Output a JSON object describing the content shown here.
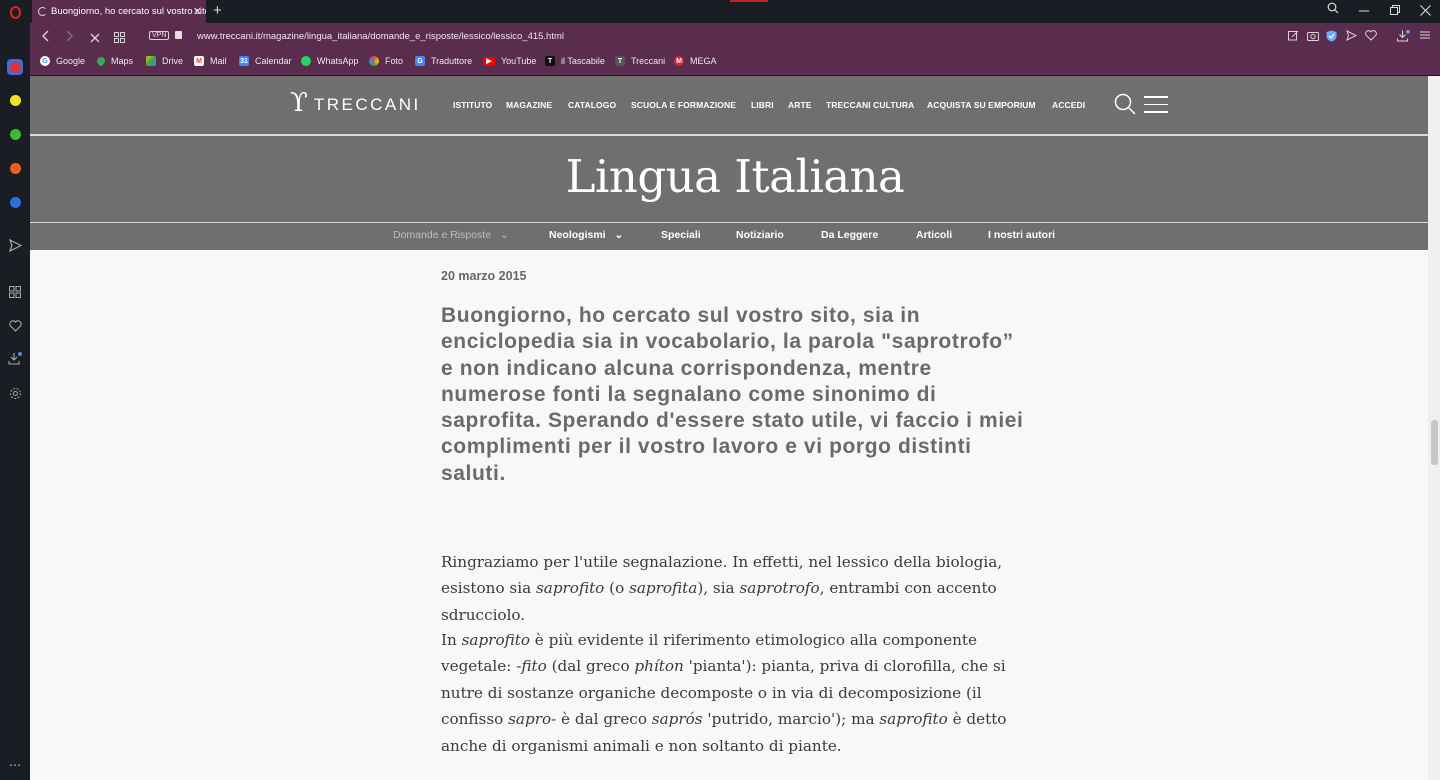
{
  "browser": {
    "tab_title": "Buongiorno, ho cercato sul vostro sito",
    "tab_close": "✕",
    "new_tab": "+",
    "url": "www.treccani.it/magazine/lingua_italiana/domande_e_risposte/lessico/lessico_415.html",
    "vpn_label": "VPN",
    "bookmarks": [
      {
        "label": "Google",
        "icon": "google-icon",
        "color": "#ffffff"
      },
      {
        "label": "Maps",
        "icon": "maps-icon",
        "color": "#34a853"
      },
      {
        "label": "Drive",
        "icon": "drive-icon",
        "color": "#fbbc05"
      },
      {
        "label": "Mail",
        "icon": "gmail-icon",
        "color": "#ea4335"
      },
      {
        "label": "Calendar",
        "icon": "calendar-icon",
        "color": "#4285f4"
      },
      {
        "label": "WhatsApp",
        "icon": "whatsapp-icon",
        "color": "#25d366"
      },
      {
        "label": "Foto",
        "icon": "photos-icon",
        "color": "#f4b400"
      },
      {
        "label": "Traduttore",
        "icon": "translate-icon",
        "color": "#4285f4"
      },
      {
        "label": "YouTube",
        "icon": "youtube-icon",
        "color": "#ff0000"
      },
      {
        "label": "il Tascabile",
        "icon": "tascabile-icon",
        "color": "#111111"
      },
      {
        "label": "Treccani",
        "icon": "treccani-icon",
        "color": "#555555"
      },
      {
        "label": "MEGA",
        "icon": "mega-icon",
        "color": "#d9272e"
      }
    ],
    "bookmark_letters": {
      "tascabile": "T",
      "treccani": "T",
      "mega": "M"
    }
  },
  "site": {
    "logo_mark": "ϒ",
    "logo_text": "TRECCANI",
    "nav": [
      "ISTITUTO",
      "MAGAZINE",
      "CATALOGO",
      "SCUOLA E FORMAZIONE",
      "LIBRI",
      "ARTE",
      "TRECCANI CULTURA",
      "ACQUISTA SU EMPORIUM",
      "ACCEDI"
    ],
    "section_title": "Lingua Italiana",
    "subnav": [
      "Domande e Risposte",
      "Neologismi",
      "Speciali",
      "Notiziario",
      "Da Leggere",
      "Articoli",
      "I nostri autori"
    ],
    "subnav_chevron": "⌄"
  },
  "article": {
    "date": "20 marzo 2015",
    "question": "Buongiorno, ho cercato sul vostro sito, sia in enciclopedia sia in vocabolario, la parola \"saprotrofo” e non indicano alcuna corrispondenza, mentre numerose fonti la segnalano come sinonimo di saprofita. Sperando d'essere stato utile, vi faccio i miei complimenti per il vostro lavoro e vi porgo distinti saluti.",
    "p1": {
      "a": "Ringraziamo per l'utile segnalazione. In effetti, nel lessico della biologia, esistono sia ",
      "b": "saprofito",
      "c": " (o ",
      "d": "saprofita",
      "e": "), sia ",
      "f": "saprotrofo",
      "g": ", entrambi con accento sdrucciolo."
    },
    "p2": {
      "a": "In ",
      "b": "saprofito",
      "c": " è più evidente il riferimento etimologico alla componente vegetale: -",
      "d": "fito",
      "e": " (dal greco ",
      "f": "phíton",
      "g": " 'pianta'): pianta, priva di clorofilla, che si nutre di sostanze organiche decomposte o in via di decomposizione (il confisso ",
      "h": "sapro-",
      "i": " è dal greco ",
      "j": "saprós",
      "k": " 'putrido, marcio'); ma ",
      "l": "saprofito",
      "m": " è detto anche di organismi animali e non soltanto di piante."
    }
  }
}
